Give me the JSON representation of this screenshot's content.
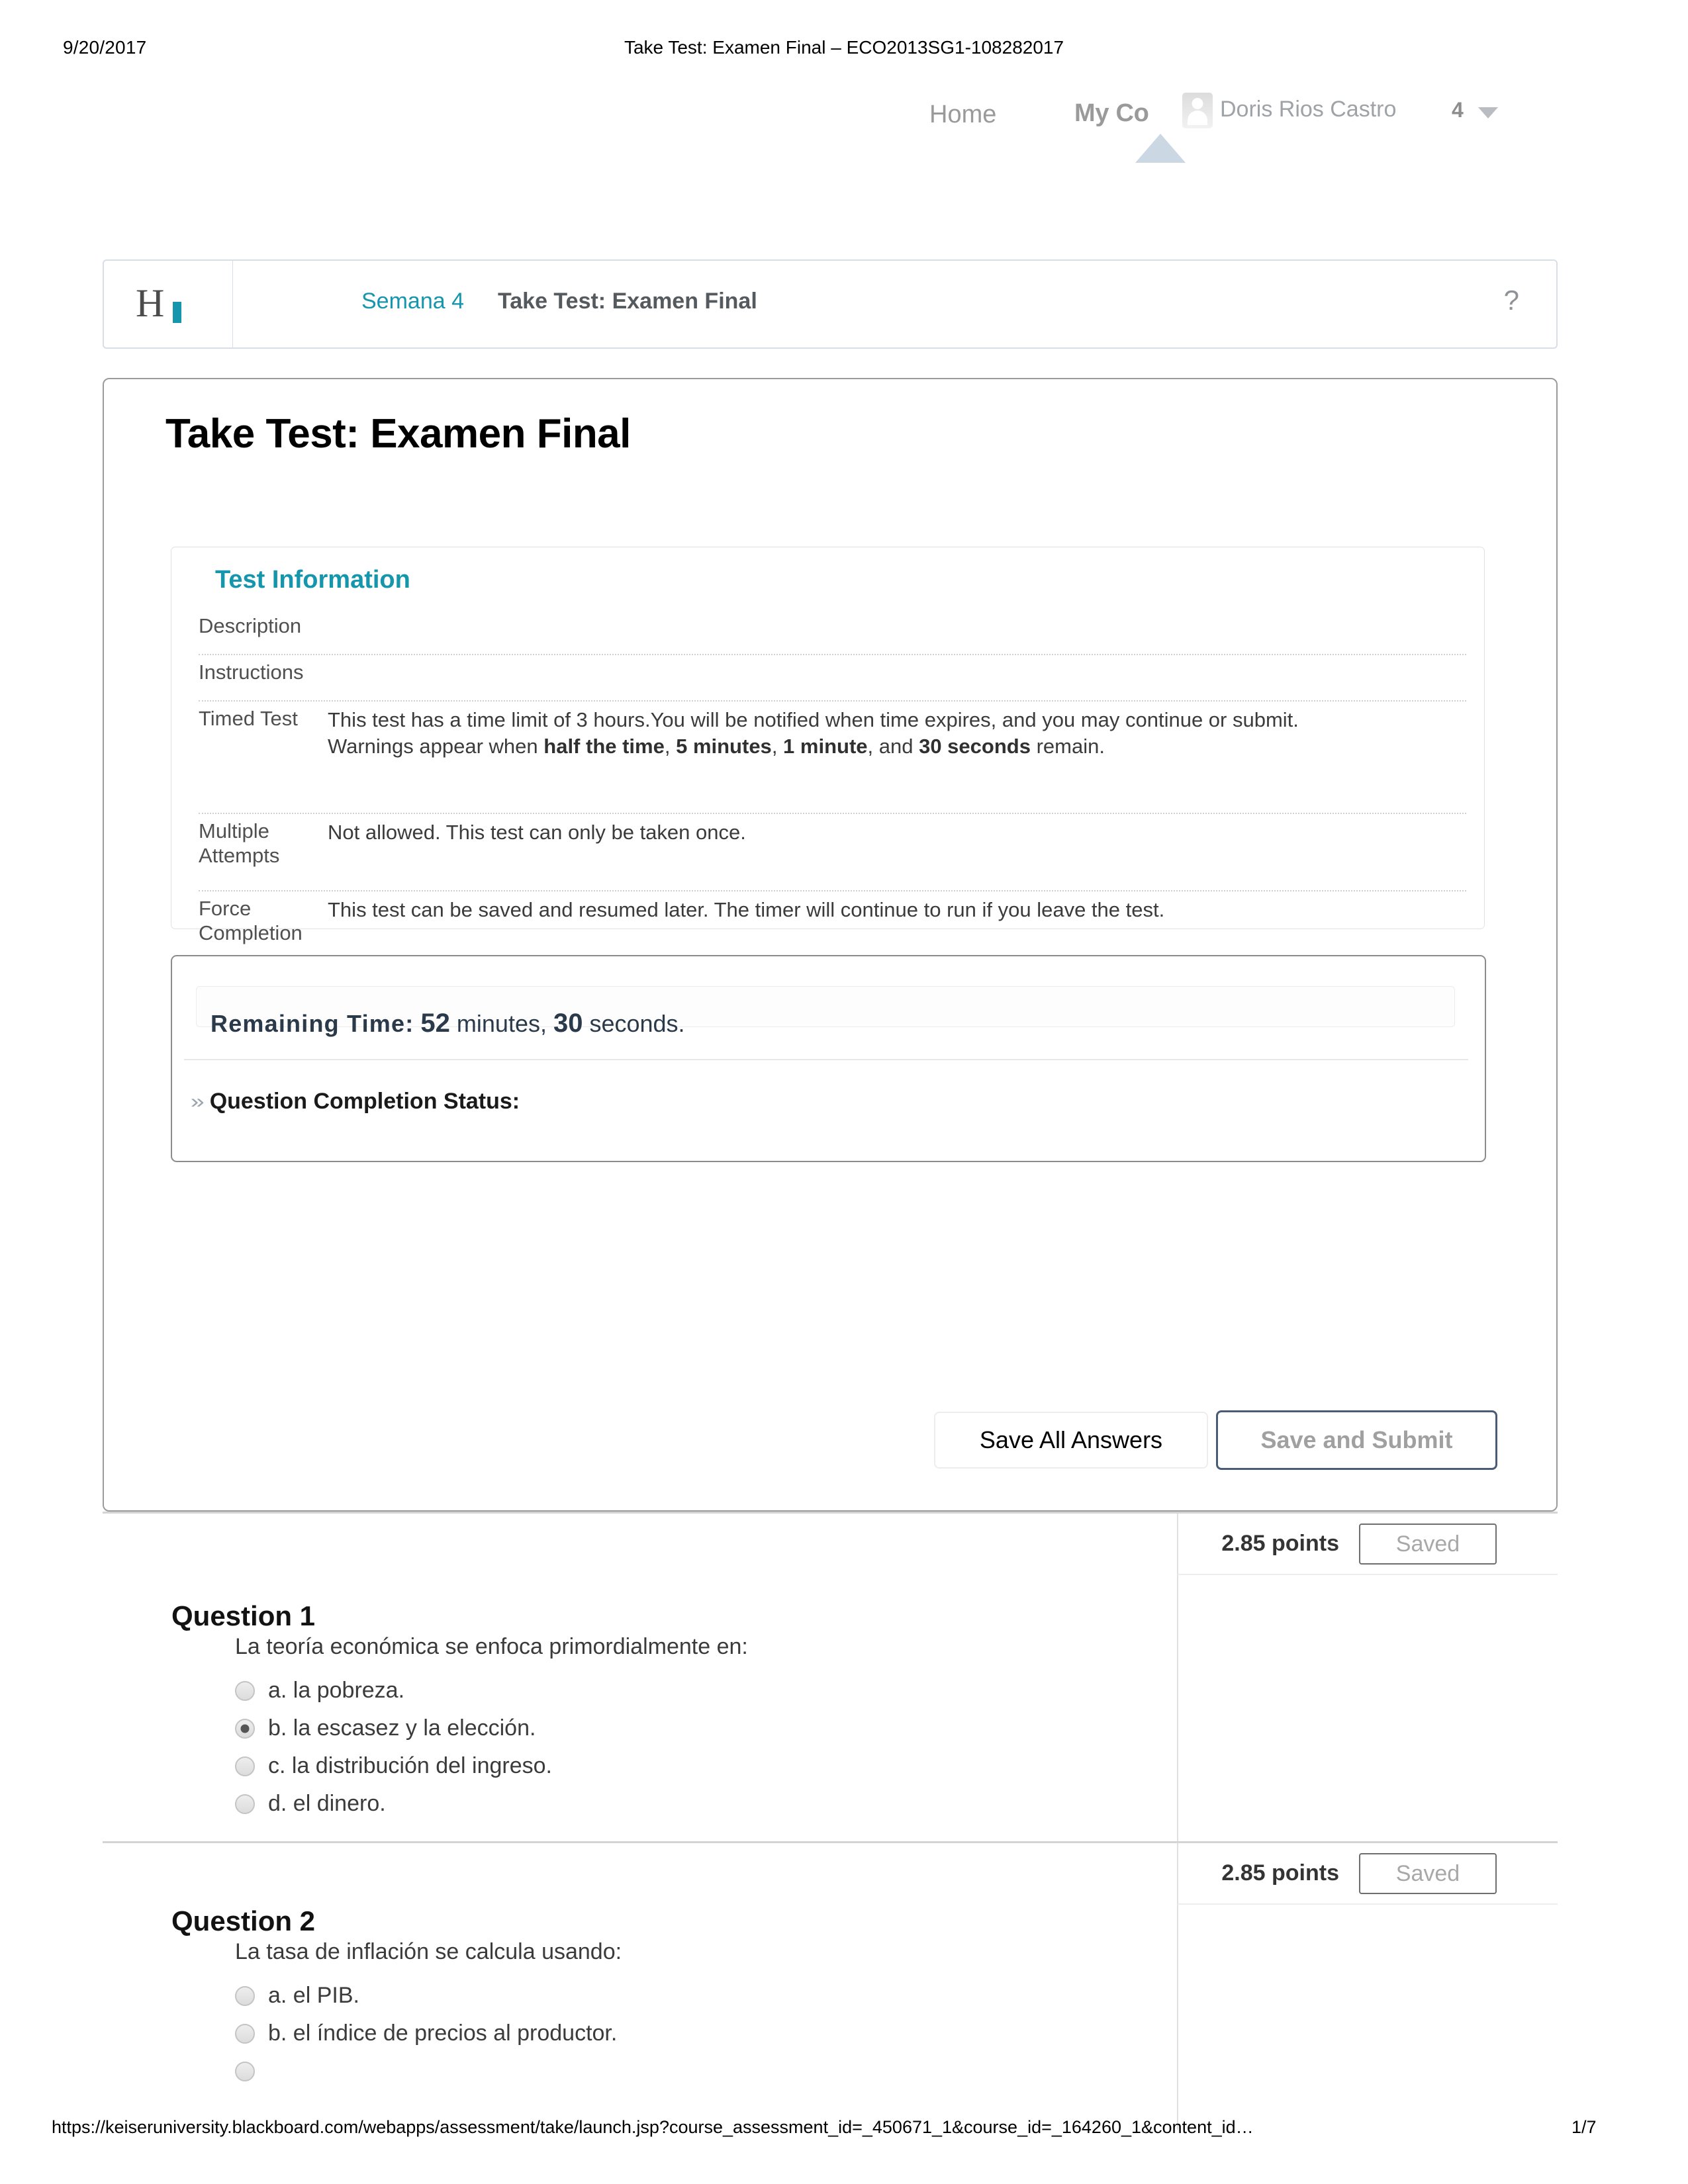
{
  "print": {
    "date": "9/20/2017",
    "title": "Take Test: Examen Final – ECO2013SG1-108282017"
  },
  "topnav": {
    "home_label": "Home",
    "my_courses_label": "My Co",
    "user_name": "Doris Rios Castro",
    "notification_count": "4"
  },
  "breadcrumb": {
    "logo_letter": "H",
    "parent_link": "Semana 4",
    "current": "Take Test: Examen Final",
    "help_glyph": "?"
  },
  "page": {
    "title": "Take Test: Examen Final"
  },
  "test_information": {
    "heading": "Test Information",
    "rows": [
      {
        "label": "Description",
        "value": ""
      },
      {
        "label": "Instructions",
        "value": ""
      },
      {
        "label": "Timed Test",
        "line1": "This test has a time limit of 3 hours.You will be notified when time expires, and you may continue or submit.",
        "line2_prefix": "Warnings appear when ",
        "line2_b1": "half the time",
        "line2_sep1": ", ",
        "line2_b2": "5 minutes",
        "line2_sep2": ", ",
        "line2_b3": "1 minute",
        "line2_sep3": ", and ",
        "line2_b4": "30 seconds",
        "line2_suffix": " remain."
      },
      {
        "label": "Multiple Attempts",
        "value": "Not allowed. This test can only be taken once."
      },
      {
        "label": "Force Completion",
        "value": "This test can be saved and resumed later. The timer will continue to run if you leave the test."
      }
    ]
  },
  "timer": {
    "label": "Remaining Time:",
    "minutes": "52",
    "minutes_word": " minutes, ",
    "seconds": "30",
    "seconds_word": " seconds.",
    "completion_status_label": "Question Completion Status:",
    "chevron_glyph": "»"
  },
  "actions": {
    "save_all_label": "Save All Answers",
    "save_submit_label": "Save and Submit"
  },
  "questions": [
    {
      "title": "Question 1",
      "points": "2.85 points",
      "status": "Saved",
      "stem": "La teoría económica se enfoca primordialmente en:",
      "options": [
        {
          "text": "a. la pobreza.",
          "selected": false
        },
        {
          "text": "b. la escasez y la elección.",
          "selected": true
        },
        {
          "text": "c. la distribución del ingreso.",
          "selected": false
        },
        {
          "text": "d. el dinero.",
          "selected": false
        }
      ]
    },
    {
      "title": "Question 2",
      "points": "2.85 points",
      "status": "Saved",
      "stem": "La tasa de inflación se calcula usando:",
      "options": [
        {
          "text": "a. el PIB.",
          "selected": false
        },
        {
          "text": "b. el índice de precios al productor.",
          "selected": false
        },
        {
          "text": "",
          "selected": false
        }
      ]
    }
  ],
  "footer": {
    "url": "https://keiseruniversity.blackboard.com/webapps/assessment/take/launch.jsp?course_assessment_id=_450671_1&course_id=_164260_1&content_id…",
    "page_number": "1/7"
  },
  "colors": {
    "accent_teal": "#1596ac",
    "link_teal": "#1596ac",
    "nav_gray": "#9a9a9a",
    "submit_border": "#4a5b77"
  }
}
